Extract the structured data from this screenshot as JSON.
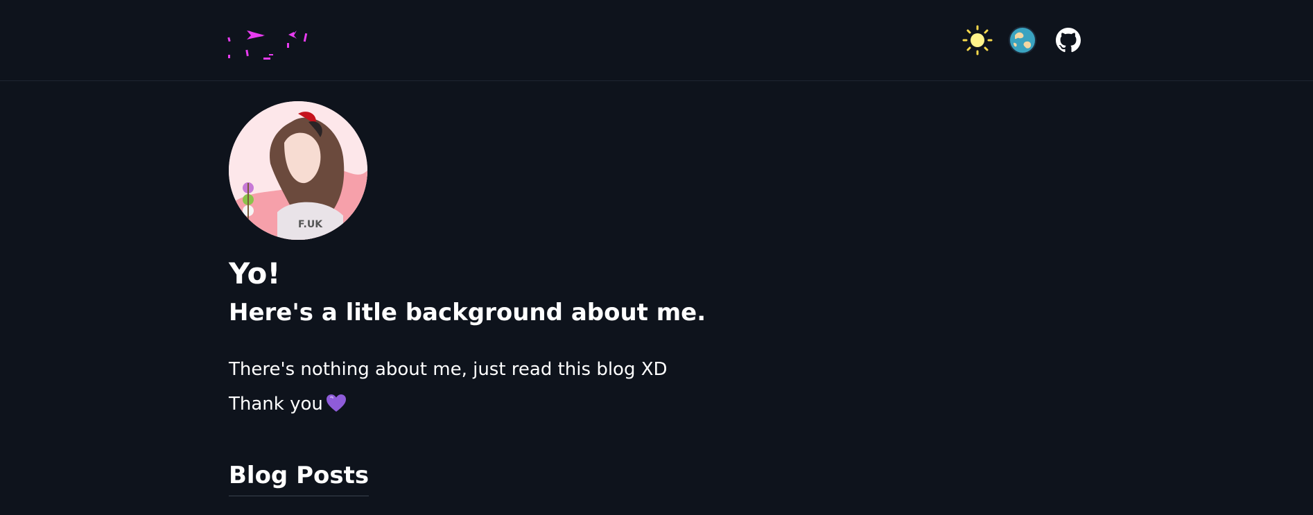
{
  "header": {
    "logo_name": "glitch-logo",
    "icons": [
      {
        "name": "sun-icon",
        "label": "toggle theme"
      },
      {
        "name": "globe-icon",
        "label": "language"
      },
      {
        "name": "github-icon",
        "label": "GitHub"
      }
    ]
  },
  "profile": {
    "avatar_name": "avatar"
  },
  "intro": {
    "title": "Yo!",
    "subtitle": "Here's a litle background about me.",
    "line1": "There's nothing about me, just read this blog XD",
    "line2": "Thank you"
  },
  "blog": {
    "section_title": "Blog Posts"
  },
  "colors": {
    "background": "#0e131c",
    "logo_accent": "#e83cf0",
    "sun": "#fff38a",
    "heart": "#8e5cd9"
  }
}
